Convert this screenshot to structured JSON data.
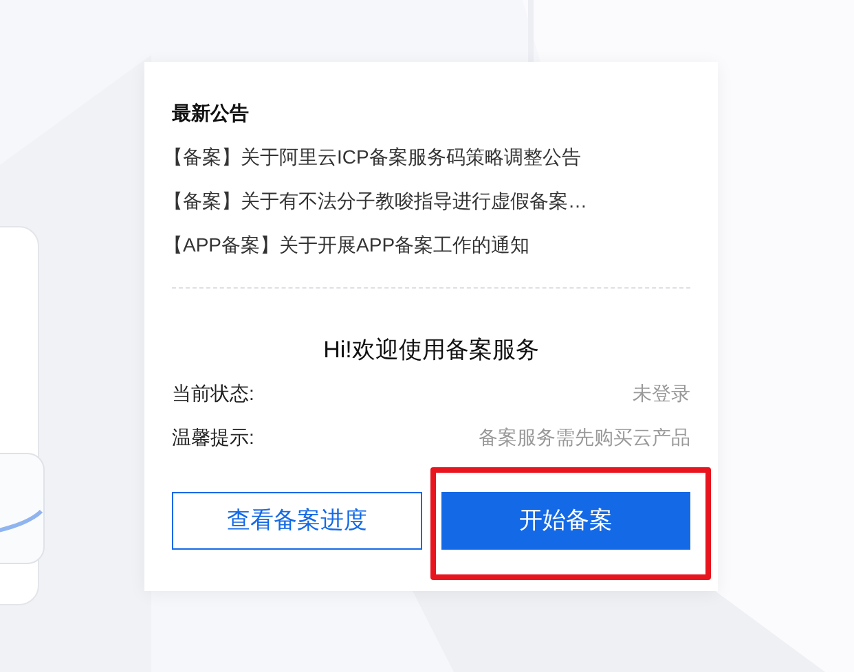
{
  "notices": {
    "title": "最新公告",
    "items": [
      "【备案】关于阿里云ICP备案服务码策略调整公告",
      "【备案】关于有不法分子教唆指导进行虚假备案…",
      "【APP备案】关于开展APP备案工作的通知"
    ]
  },
  "welcome": {
    "title": "Hi!欢迎使用备案服务",
    "rows": [
      {
        "label": "当前状态:",
        "value": "未登录"
      },
      {
        "label": "温馨提示:",
        "value": "备案服务需先购买云产品"
      }
    ]
  },
  "buttons": [
    {
      "label": "查看备案进度",
      "kind": "outline",
      "highlighted": false
    },
    {
      "label": "开始备案",
      "kind": "primary",
      "highlighted": true
    }
  ]
}
